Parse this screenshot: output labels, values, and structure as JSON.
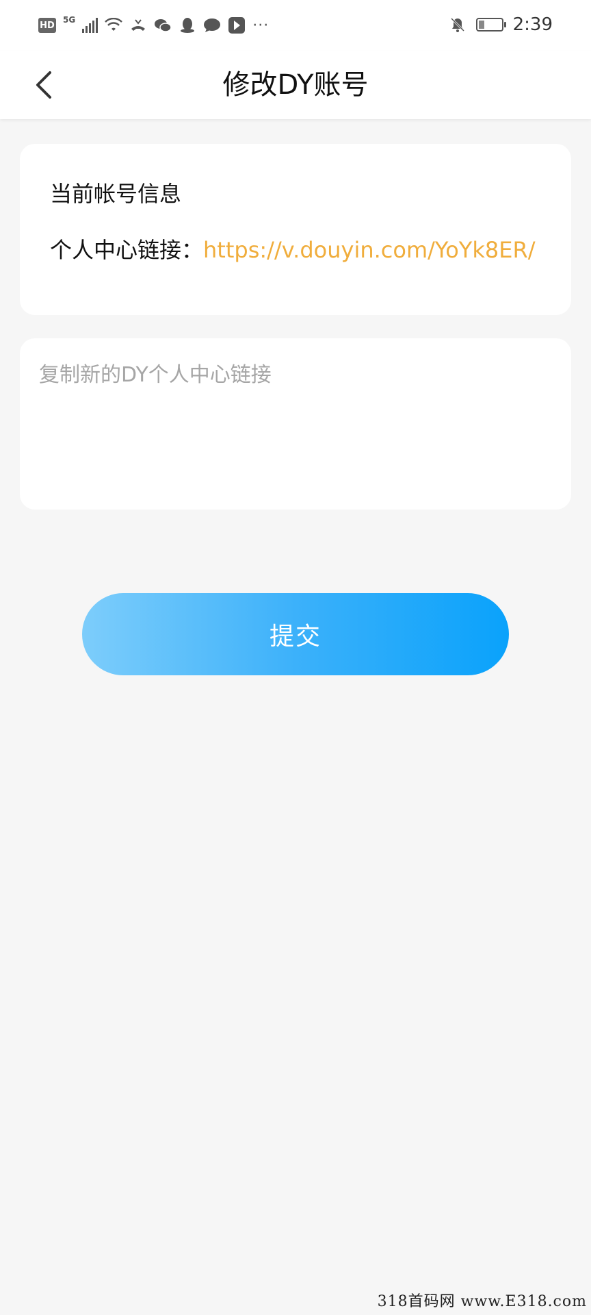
{
  "status_bar": {
    "network_badge": "HD",
    "network_type": "5G",
    "more": "···",
    "time": "2:39",
    "icons": [
      "hd-icon",
      "signal-icon",
      "wifi-icon",
      "missed-call-icon",
      "wechat-icon",
      "qq-icon",
      "message-icon",
      "app-icon",
      "mute-icon",
      "battery-icon"
    ]
  },
  "header": {
    "title": "修改DY账号"
  },
  "info_card": {
    "title": "当前帐号信息",
    "link_label": "个人中心链接：",
    "link_value": "https://v.douyin.com/YoYk8ER/"
  },
  "input_card": {
    "placeholder": "复制新的DY个人中心链接",
    "value": ""
  },
  "actions": {
    "submit_label": "提交"
  },
  "watermark": "318首码网 www.E318.com",
  "colors": {
    "link": "#f0ad3c",
    "button_start": "#7dcdfb",
    "button_end": "#0aa2fb",
    "background": "#f6f6f6"
  }
}
